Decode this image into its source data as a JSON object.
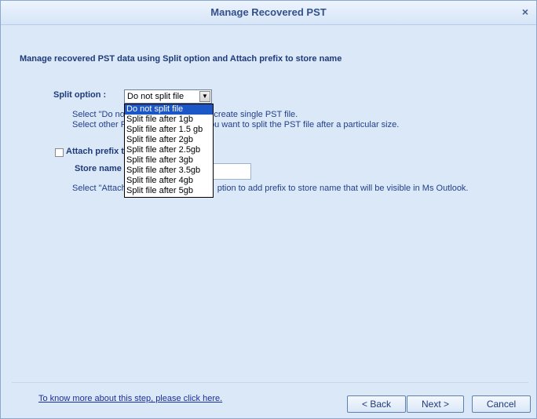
{
  "window": {
    "title": "Manage Recovered PST",
    "close_label": "×"
  },
  "main": {
    "heading": "Manage recovered PST data using Split option and Attach prefix to store name",
    "split_label": "Split option :",
    "split_selected": "Do not split file",
    "desc_line1_a": "Select \"Do no",
    "desc_line1_b": "want to create single PST file.",
    "desc_line2_a": "Select other F",
    "desc_line2_b": "you want to split the PST file after a particular size.",
    "attach_label": "Attach prefix t",
    "store_label": "Store name",
    "store_value": "",
    "attach_desc_a": "Select \"Attach",
    "attach_desc_b": "ption to add prefix to store name that will be visible in Ms Outlook."
  },
  "dropdown": {
    "options": [
      "Do not split file",
      "Split file after 1gb",
      "Split file after 1.5 gb",
      "Split file after 2gb",
      "Split file after 2.5gb",
      "Split file after 3gb",
      "Split file after 3.5gb",
      "Split file after 4gb",
      "Split file after 5gb"
    ],
    "selected_index": 0
  },
  "footer": {
    "help_link": "To know more about this step, please click here.",
    "back": "< Back",
    "next": "Next >",
    "cancel": "Cancel"
  }
}
